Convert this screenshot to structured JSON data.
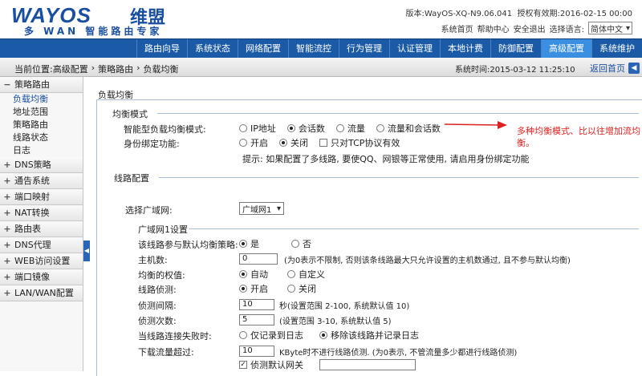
{
  "brand": {
    "logo": "WAYOS",
    "logo_cn": "维盟",
    "slogan": "多 WAN 智能路由专家"
  },
  "header": {
    "version": "版本:WayOS-XQ-N9.06.041",
    "license": "授权有效期:2016-02-15 00:00",
    "links": [
      "系统首页",
      "帮助中心",
      "安全退出",
      "选择语言:"
    ],
    "language": "简体中文"
  },
  "nav": [
    "路由向导",
    "系统状态",
    "网络配置",
    "智能流控",
    "行为管理",
    "认证管理",
    "本地计费",
    "防御配置",
    "高级配置",
    "系统维护"
  ],
  "nav_active": "高级配置",
  "breadcrumb": [
    "当前位置:高级配置",
    "›",
    "策略路由",
    "›",
    "负载均衡"
  ],
  "systime": "系统时间:2015-03-12 11:25:10",
  "back_label": "返回首页",
  "sidebar": {
    "open_section": "策略路由",
    "sub_items": [
      "负载均衡",
      "地址范围",
      "策略路由",
      "线路状态",
      "日志"
    ],
    "sections": [
      "DNS策略",
      "通告系统",
      "端口映射",
      "NAT转换",
      "路由表",
      "DNS代理",
      "WEB访问设置",
      "端口镜像",
      "LAN/WAN配置"
    ]
  },
  "content": {
    "title": "负载均衡",
    "balance": {
      "header": "均衡模式",
      "mode_label": "智能型负载均衡模式:",
      "mode_options": [
        "IP地址",
        "会话数",
        "流量",
        "流量和会话数"
      ],
      "mode_selected": "会话数",
      "bind_label": "身份绑定功能:",
      "bind_options": [
        "开启",
        "关闭"
      ],
      "bind_selected": "关闭",
      "tcp_only": "只对TCP协议有效",
      "hint": "提示: 如果配置了多线路, 要使QQ、网银等正常使用, 请启用身份绑定功能"
    },
    "line": {
      "header": "线路配置",
      "select_label": "选择广域网:",
      "select_value": "广域网1",
      "wan_header": "广域网1设置",
      "join_label": "该线路参与默认均衡策略:",
      "join_options": [
        "是",
        "否"
      ],
      "join_selected": "是",
      "hosts_label": "主机数:",
      "hosts_value": "0",
      "hosts_note": "(为0表示不限制, 否则该条线路最大只允许设置的主机数通过, 且不参与默认均衡)",
      "weight_label": "均衡的权值:",
      "weight_options": [
        "自动",
        "自定义"
      ],
      "weight_selected": "自动",
      "detect_label": "线路侦测:",
      "detect_options": [
        "开启",
        "关闭"
      ],
      "detect_selected": "开启",
      "interval_label": "侦测间隔:",
      "interval_value": "10",
      "interval_note": "秒(设置范围 2-100, 系统默认值 10)",
      "count_label": "侦测次数:",
      "count_value": "5",
      "count_note": "(设置范围 3-10, 系统默认值 5)",
      "fail_label": "当线路连接失败时:",
      "fail_options": [
        "仅记录到日志",
        "移除该线路并记录日志"
      ],
      "fail_selected": "移除该线路并记录日志",
      "traffic_label": "下载流量超过:",
      "traffic_value": "10",
      "traffic_note": "KByte时不进行线路侦测. (为0表示, 不管流量多少都进行线路侦测)",
      "gateway_label": "侦测默认网关",
      "gateway_checked": true
    }
  },
  "annotation": "多种均衡模式、比以往增加流均衡。"
}
